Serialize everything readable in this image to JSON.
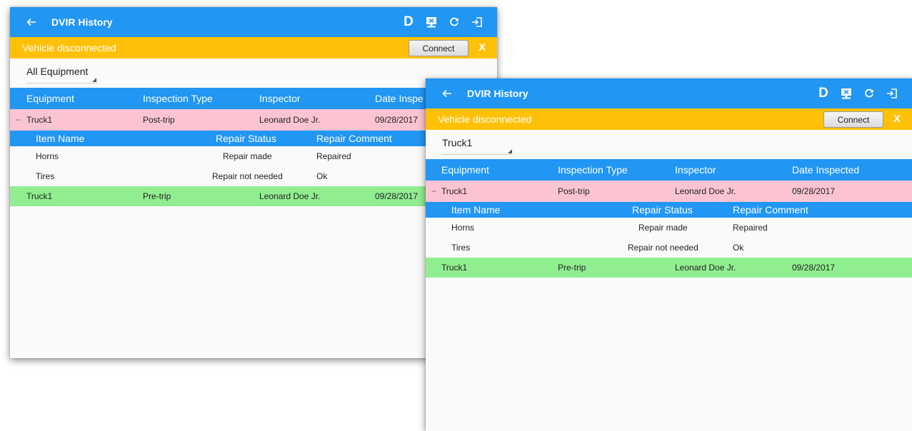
{
  "screens": [
    {
      "id": "back",
      "app_title": "DVIR History",
      "banner": {
        "text": "Vehicle disconnected",
        "connect_label": "Connect",
        "close_label": "X"
      },
      "filter": {
        "selected": "All Equipment"
      },
      "columns": [
        "Equipment",
        "Inspection Type",
        "Inspector",
        "Date Inspe"
      ],
      "records": [
        {
          "equipment": "Truck1",
          "type": "Post-trip",
          "inspector": "Leonard Doe Jr.",
          "date": "09/28/2017",
          "status": "defect",
          "expanded": true,
          "collapse_symbol": "−",
          "item_columns": [
            "Item Name",
            "Repair Status",
            "Repair Comment"
          ],
          "items": [
            {
              "name": "Horns",
              "status": "Repair made",
              "comment": "Repaired"
            },
            {
              "name": "Tires",
              "status": "Repair not needed",
              "comment": "Ok"
            }
          ]
        },
        {
          "equipment": "Truck1",
          "type": "Pre-trip",
          "inspector": "Leonard Doe Jr.",
          "date": "09/28/2017",
          "status": "ok",
          "expanded": false
        }
      ]
    },
    {
      "id": "front",
      "app_title": "DVIR History",
      "banner": {
        "text": "Vehicle disconnected",
        "connect_label": "Connect",
        "close_label": "X"
      },
      "filter": {
        "selected": "Truck1"
      },
      "columns": [
        "Equipment",
        "Inspection Type",
        "Inspector",
        "Date Inspected"
      ],
      "records": [
        {
          "equipment": "Truck1",
          "type": "Post-trip",
          "inspector": "Leonard Doe Jr.",
          "date": "09/28/2017",
          "status": "defect",
          "expanded": true,
          "collapse_symbol": "−",
          "item_columns": [
            "Item Name",
            "Repair Status",
            "Repair Comment"
          ],
          "items": [
            {
              "name": "Horns",
              "status": "Repair made",
              "comment": "Repaired"
            },
            {
              "name": "Tires",
              "status": "Repair not needed",
              "comment": "Ok"
            }
          ]
        },
        {
          "equipment": "Truck1",
          "type": "Pre-trip",
          "inspector": "Leonard Doe Jr.",
          "date": "09/28/2017",
          "status": "ok",
          "expanded": false
        }
      ]
    }
  ],
  "toolbar": {
    "d_label": "D",
    "icons": [
      "back-arrow-icon",
      "report-transfer-icon",
      "refresh-icon",
      "logout-icon"
    ]
  },
  "colors": {
    "primary": "#2196f3",
    "banner": "#ffc107",
    "defect_row": "#fcc4d2",
    "ok_row": "#90ee90",
    "background": "#fafafa"
  }
}
